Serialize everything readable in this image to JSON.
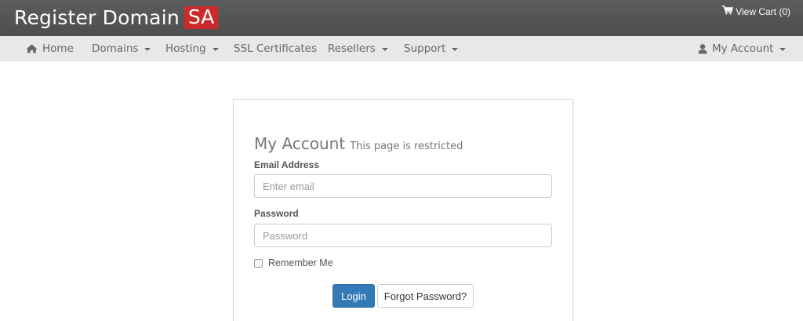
{
  "header": {
    "logo_text": "Register Domain",
    "logo_badge": "SA",
    "cart_label": "View Cart (0)",
    "accent_color": "#cc2a2a"
  },
  "nav": {
    "items": [
      {
        "label": "Home",
        "icon": "home-icon",
        "dropdown": false
      },
      {
        "label": "Domains",
        "dropdown": true
      },
      {
        "label": "Hosting",
        "dropdown": true
      },
      {
        "label": "SSL Certificates",
        "dropdown": false
      },
      {
        "label": "Resellers",
        "dropdown": true
      },
      {
        "label": "Support",
        "dropdown": true
      }
    ],
    "account": {
      "label": "My Account",
      "icon": "user-icon",
      "dropdown": true
    }
  },
  "login": {
    "title": "My Account",
    "subtitle": "This page is restricted",
    "email_label": "Email Address",
    "email_placeholder": "Enter email",
    "password_label": "Password",
    "password_placeholder": "Password",
    "remember_label": "Remember Me",
    "login_button": "Login",
    "forgot_button": "Forgot Password?",
    "primary_color": "#337ab7"
  }
}
